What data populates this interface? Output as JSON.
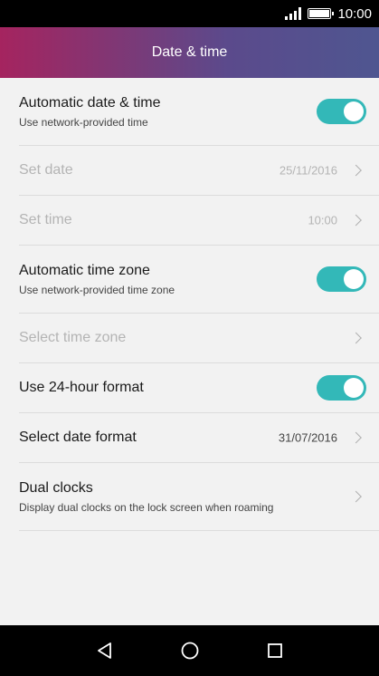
{
  "status": {
    "time": "10:00"
  },
  "header": {
    "title": "Date & time"
  },
  "settings": {
    "auto_datetime": {
      "label": "Automatic date & time",
      "sub": "Use network-provided time"
    },
    "set_date": {
      "label": "Set date",
      "value": "25/11/2016"
    },
    "set_time": {
      "label": "Set time",
      "value": "10:00"
    },
    "auto_timezone": {
      "label": "Automatic time zone",
      "sub": "Use network-provided time zone"
    },
    "select_timezone": {
      "label": "Select time zone"
    },
    "use_24h": {
      "label": "Use 24-hour format"
    },
    "date_format": {
      "label": "Select date format",
      "value": "31/07/2016"
    },
    "dual_clocks": {
      "label": "Dual clocks",
      "sub": "Display dual clocks on the lock screen when roaming"
    }
  },
  "icons": {
    "back": "back-icon",
    "home": "home-icon",
    "recents": "recents-icon"
  },
  "colors": {
    "accent": "#33b8b8"
  }
}
